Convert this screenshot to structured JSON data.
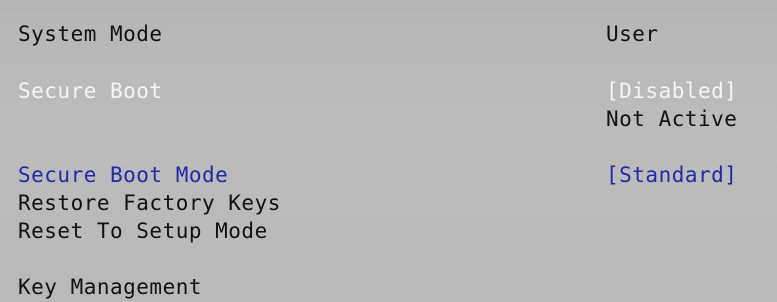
{
  "settings": {
    "system_mode": {
      "label": "System Mode",
      "value": "User"
    },
    "secure_boot": {
      "label": "Secure Boot",
      "value": "[Disabled]",
      "status": "Not Active"
    },
    "secure_boot_mode": {
      "label": "Secure Boot Mode",
      "value": "[Standard]"
    },
    "restore_factory_keys": {
      "label": "Restore Factory Keys"
    },
    "reset_to_setup_mode": {
      "label": "Reset To Setup Mode"
    },
    "key_management": {
      "label": "Key Management"
    }
  },
  "colors": {
    "background": "#b8b8b8",
    "text": "#111111",
    "highlight_white": "#f5f5f5",
    "selected_blue": "#1f2aa6"
  }
}
